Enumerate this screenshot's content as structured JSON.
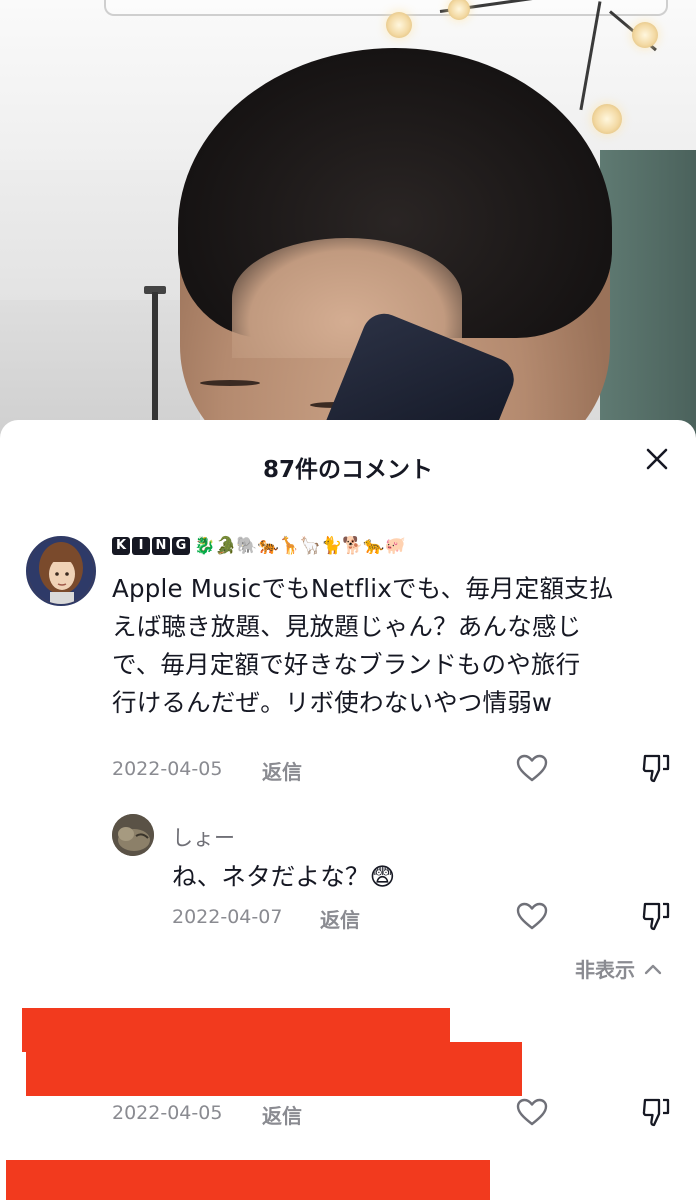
{
  "sheet": {
    "title": "87件のコメント"
  },
  "comments": [
    {
      "username_letters": [
        "K",
        "I",
        "N",
        "G"
      ],
      "username_suffix": "🐉🐊🐘🐅🦒🦙🐈🐕🐆🐖",
      "text": "Apple MusicでもNetflixでも、毎月定額支払えば聴き放題、見放題じゃん？あんな感じで、毎月定額で好きなブランドものや旅行行けるんだぜ。リボ使わないやつ情弱w",
      "lines": [
        "Apple MusicでもNetflixでも、毎月定額支払",
        "えば聴き放題、見放題じゃん？あんな感じ",
        "で、毎月定額で好きなブランドものや旅行",
        "行けるんだぜ。リボ使わないやつ情弱w"
      ],
      "date": "2022-04-05",
      "reply_label": "返信"
    },
    {
      "username": "しょー",
      "text": "ね、ネタだよな？😨",
      "date": "2022-04-07",
      "reply_label": "返信"
    },
    {
      "date": "2022-04-05",
      "reply_label": "返信"
    }
  ],
  "hide_replies_label": "非表示",
  "colors": {
    "redaction": "#f23a1e",
    "text_primary": "#161823",
    "text_secondary": "#8a8b91"
  },
  "icons": [
    "close-icon",
    "heart-icon",
    "dislike-icon",
    "chevron-up-icon"
  ]
}
